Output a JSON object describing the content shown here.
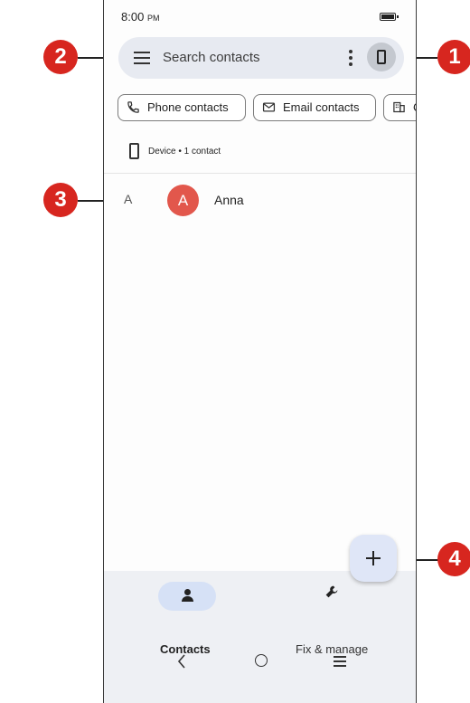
{
  "status_bar": {
    "time": "8:00",
    "ampm": "PM"
  },
  "search": {
    "placeholder": "Search contacts"
  },
  "chips": [
    {
      "label": "Phone contacts"
    },
    {
      "label": "Email contacts"
    },
    {
      "label": "C"
    }
  ],
  "device": {
    "label": "Device • 1 contact"
  },
  "contacts": [
    {
      "letter": "A",
      "initial": "A",
      "name": "Anna",
      "avatar_color": "#e2574c"
    }
  ],
  "bottom_nav": {
    "items": [
      {
        "label": "Contacts",
        "selected": true,
        "icon": "person-icon"
      },
      {
        "label": "Fix & manage",
        "selected": false,
        "icon": "wrench-icon"
      }
    ]
  },
  "callouts": [
    "1",
    "2",
    "3",
    "4"
  ],
  "colors": {
    "callout": "#d7261f",
    "search_bg": "#e7eaf1",
    "fab_bg": "#dfe6f7",
    "nav_bg": "#eef0f4",
    "nav_pill": "#d6e1f6"
  }
}
